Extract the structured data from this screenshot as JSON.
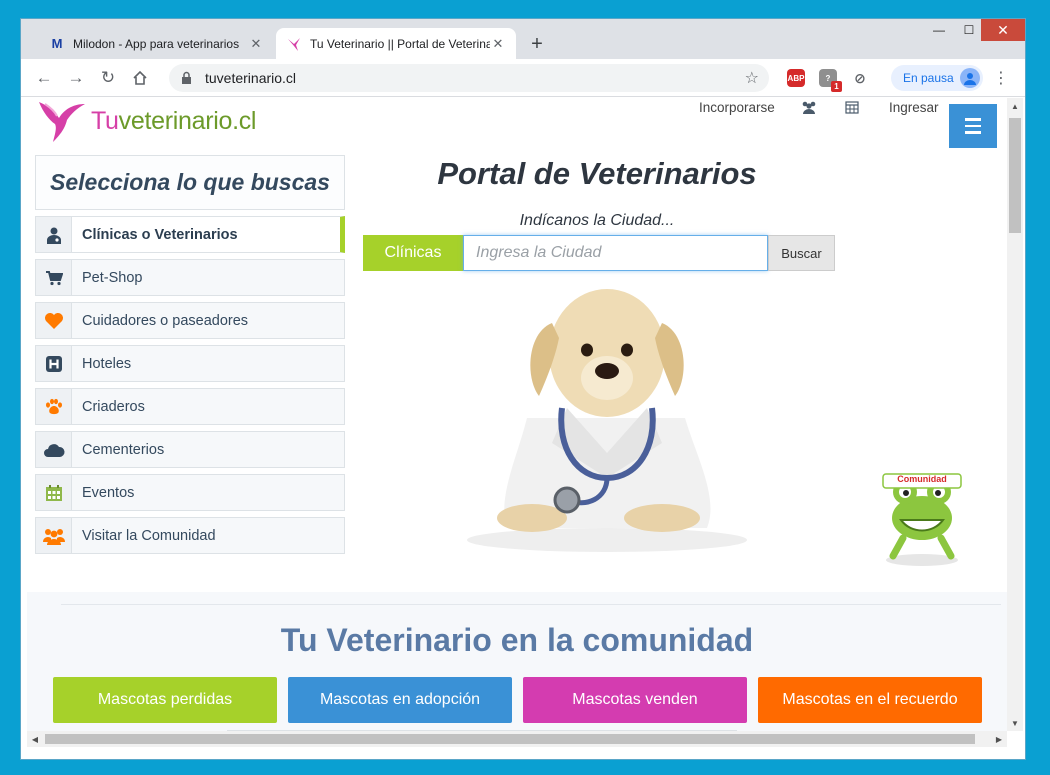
{
  "browser": {
    "tabs": [
      {
        "title": "Milodon - App para veterinarios",
        "favicon": "M",
        "active": false
      },
      {
        "title": "Tu Veterinario || Portal de Veterinarios",
        "active": true
      }
    ],
    "url": "tuveterinario.cl",
    "profile_label": "En pausa",
    "extensions": {
      "abp_label": "ABP",
      "badge_count": "1"
    }
  },
  "site": {
    "logo": {
      "tu": "Tu",
      "rest": "veterinario.cl"
    },
    "nav": {
      "join": "Incorporarse",
      "login": "Ingresar"
    }
  },
  "sidebar": {
    "title": "Selecciona lo que buscas",
    "items": [
      {
        "label": "Clínicas o Veterinarios",
        "icon": "doctor-icon",
        "active": true
      },
      {
        "label": "Pet-Shop",
        "icon": "cart-icon"
      },
      {
        "label": "Cuidadores o paseadores",
        "icon": "heart-icon"
      },
      {
        "label": "Hoteles",
        "icon": "hotel-icon"
      },
      {
        "label": "Criaderos",
        "icon": "paw-icon"
      },
      {
        "label": "Cementerios",
        "icon": "cloud-icon"
      },
      {
        "label": "Eventos",
        "icon": "calendar-icon"
      },
      {
        "label": "Visitar la Comunidad",
        "icon": "users-icon"
      }
    ]
  },
  "main": {
    "title": "Portal de Veterinarios",
    "hint": "Indícanos la Ciudad...",
    "category_button": "Clínicas",
    "search_placeholder": "Ingresa la Ciudad",
    "search_value": "",
    "search_button": "Buscar",
    "badge_text": "Comunidad"
  },
  "community": {
    "title": "Tu Veterinario en la comunidad",
    "buttons": [
      {
        "label": "Mascotas perdidas",
        "color": "#a6d12a"
      },
      {
        "label": "Mascotas en adopción",
        "color": "#3a91d6"
      },
      {
        "label": "Mascotas venden",
        "color": "#d43cb0"
      },
      {
        "label": "Mascotas en el recuerdo",
        "color": "#ff6a00"
      }
    ]
  },
  "colors": {
    "accent_green": "#a6d12a",
    "brand_blue": "#3a91d6",
    "logo_pink": "#d63fa7",
    "text_dark": "#34495e"
  }
}
